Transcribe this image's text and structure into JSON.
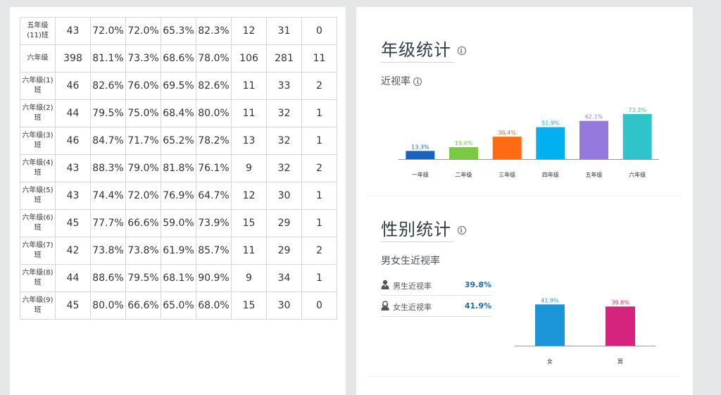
{
  "table": {
    "rows": [
      [
        "五年级\n(11)班",
        "43",
        "72.0%",
        "72.0%",
        "65.3%",
        "82.3%",
        "12",
        "31",
        "0"
      ],
      [
        "六年级",
        "398",
        "81.1%",
        "73.3%",
        "68.6%",
        "78.0%",
        "106",
        "281",
        "11"
      ],
      [
        "六年级(1)\n班",
        "46",
        "82.6%",
        "76.0%",
        "69.5%",
        "82.6%",
        "11",
        "33",
        "2"
      ],
      [
        "六年级(2)\n班",
        "44",
        "79.5%",
        "75.0%",
        "68.4%",
        "80.0%",
        "11",
        "32",
        "1"
      ],
      [
        "六年级(3)\n班",
        "46",
        "84.7%",
        "71.7%",
        "65.2%",
        "78.2%",
        "13",
        "32",
        "1"
      ],
      [
        "六年级(4)\n班",
        "43",
        "88.3%",
        "79.0%",
        "81.8%",
        "76.1%",
        "9",
        "32",
        "2"
      ],
      [
        "六年级(5)\n班",
        "43",
        "74.4%",
        "72.0%",
        "76.9%",
        "64.7%",
        "12",
        "30",
        "1"
      ],
      [
        "六年级(6)\n班",
        "45",
        "77.7%",
        "66.6%",
        "59.0%",
        "73.9%",
        "15",
        "29",
        "1"
      ],
      [
        "六年级(7)\n班",
        "42",
        "73.8%",
        "73.8%",
        "61.9%",
        "85.7%",
        "11",
        "29",
        "2"
      ],
      [
        "六年级(8)\n班",
        "44",
        "88.6%",
        "79.5%",
        "68.1%",
        "90.9%",
        "9",
        "34",
        "1"
      ],
      [
        "六年级(9)\n班",
        "45",
        "80.0%",
        "66.6%",
        "65.0%",
        "68.0%",
        "15",
        "30",
        "0"
      ]
    ]
  },
  "grade_section": {
    "title": "年级统计",
    "info_icon": "info-icon",
    "subtitle": "近视率"
  },
  "gender_section": {
    "title": "性别统计",
    "info_icon": "info-icon",
    "subtitle": "男女生近视率",
    "rows": [
      {
        "icon": "male-student-icon",
        "label": "男生近视率",
        "value": "39.8%"
      },
      {
        "icon": "female-student-icon",
        "label": "女生近视率",
        "value": "41.9%"
      }
    ]
  },
  "chart_data": [
    {
      "type": "bar",
      "categories": [
        "一年级",
        "二年级",
        "三年级",
        "四年级",
        "五年级",
        "六年级"
      ],
      "values": [
        13.3,
        19.4,
        36.4,
        51.9,
        62.1,
        73.3
      ],
      "value_labels": [
        "13.3%",
        "19.4%",
        "36.4%",
        "51.9%",
        "62.1%",
        "73.3%"
      ],
      "colors": [
        "#1565c0",
        "#7ac943",
        "#ff6a13",
        "#00b0f0",
        "#9478dd",
        "#2ec4c9"
      ],
      "title": "",
      "xlabel": "",
      "ylabel": "",
      "ylim": [
        0,
        80
      ],
      "grid": false,
      "legend": "none"
    },
    {
      "type": "bar",
      "categories": [
        "女",
        "男"
      ],
      "values": [
        41.9,
        39.8
      ],
      "value_labels": [
        "41.9%",
        "39.8%"
      ],
      "colors": [
        "#1b95d8",
        "#d6237d"
      ],
      "title": "",
      "xlabel": "",
      "ylabel": "",
      "ylim": [
        0,
        45
      ],
      "grid": false,
      "legend": "none"
    }
  ]
}
